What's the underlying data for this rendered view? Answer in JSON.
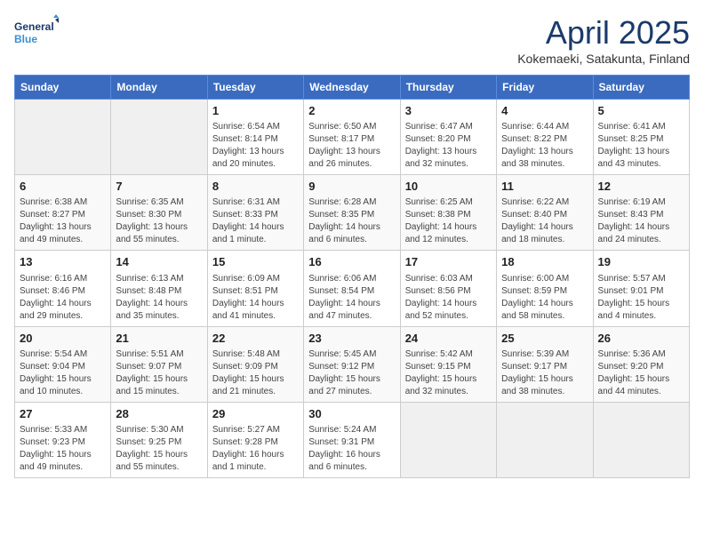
{
  "header": {
    "logo_line1": "General",
    "logo_line2": "Blue",
    "month_title": "April 2025",
    "location": "Kokemaeki, Satakunta, Finland"
  },
  "weekdays": [
    "Sunday",
    "Monday",
    "Tuesday",
    "Wednesday",
    "Thursday",
    "Friday",
    "Saturday"
  ],
  "weeks": [
    [
      {
        "day": "",
        "sunrise": "",
        "sunset": "",
        "daylight": ""
      },
      {
        "day": "",
        "sunrise": "",
        "sunset": "",
        "daylight": ""
      },
      {
        "day": "1",
        "sunrise": "Sunrise: 6:54 AM",
        "sunset": "Sunset: 8:14 PM",
        "daylight": "Daylight: 13 hours and 20 minutes."
      },
      {
        "day": "2",
        "sunrise": "Sunrise: 6:50 AM",
        "sunset": "Sunset: 8:17 PM",
        "daylight": "Daylight: 13 hours and 26 minutes."
      },
      {
        "day": "3",
        "sunrise": "Sunrise: 6:47 AM",
        "sunset": "Sunset: 8:20 PM",
        "daylight": "Daylight: 13 hours and 32 minutes."
      },
      {
        "day": "4",
        "sunrise": "Sunrise: 6:44 AM",
        "sunset": "Sunset: 8:22 PM",
        "daylight": "Daylight: 13 hours and 38 minutes."
      },
      {
        "day": "5",
        "sunrise": "Sunrise: 6:41 AM",
        "sunset": "Sunset: 8:25 PM",
        "daylight": "Daylight: 13 hours and 43 minutes."
      }
    ],
    [
      {
        "day": "6",
        "sunrise": "Sunrise: 6:38 AM",
        "sunset": "Sunset: 8:27 PM",
        "daylight": "Daylight: 13 hours and 49 minutes."
      },
      {
        "day": "7",
        "sunrise": "Sunrise: 6:35 AM",
        "sunset": "Sunset: 8:30 PM",
        "daylight": "Daylight: 13 hours and 55 minutes."
      },
      {
        "day": "8",
        "sunrise": "Sunrise: 6:31 AM",
        "sunset": "Sunset: 8:33 PM",
        "daylight": "Daylight: 14 hours and 1 minute."
      },
      {
        "day": "9",
        "sunrise": "Sunrise: 6:28 AM",
        "sunset": "Sunset: 8:35 PM",
        "daylight": "Daylight: 14 hours and 6 minutes."
      },
      {
        "day": "10",
        "sunrise": "Sunrise: 6:25 AM",
        "sunset": "Sunset: 8:38 PM",
        "daylight": "Daylight: 14 hours and 12 minutes."
      },
      {
        "day": "11",
        "sunrise": "Sunrise: 6:22 AM",
        "sunset": "Sunset: 8:40 PM",
        "daylight": "Daylight: 14 hours and 18 minutes."
      },
      {
        "day": "12",
        "sunrise": "Sunrise: 6:19 AM",
        "sunset": "Sunset: 8:43 PM",
        "daylight": "Daylight: 14 hours and 24 minutes."
      }
    ],
    [
      {
        "day": "13",
        "sunrise": "Sunrise: 6:16 AM",
        "sunset": "Sunset: 8:46 PM",
        "daylight": "Daylight: 14 hours and 29 minutes."
      },
      {
        "day": "14",
        "sunrise": "Sunrise: 6:13 AM",
        "sunset": "Sunset: 8:48 PM",
        "daylight": "Daylight: 14 hours and 35 minutes."
      },
      {
        "day": "15",
        "sunrise": "Sunrise: 6:09 AM",
        "sunset": "Sunset: 8:51 PM",
        "daylight": "Daylight: 14 hours and 41 minutes."
      },
      {
        "day": "16",
        "sunrise": "Sunrise: 6:06 AM",
        "sunset": "Sunset: 8:54 PM",
        "daylight": "Daylight: 14 hours and 47 minutes."
      },
      {
        "day": "17",
        "sunrise": "Sunrise: 6:03 AM",
        "sunset": "Sunset: 8:56 PM",
        "daylight": "Daylight: 14 hours and 52 minutes."
      },
      {
        "day": "18",
        "sunrise": "Sunrise: 6:00 AM",
        "sunset": "Sunset: 8:59 PM",
        "daylight": "Daylight: 14 hours and 58 minutes."
      },
      {
        "day": "19",
        "sunrise": "Sunrise: 5:57 AM",
        "sunset": "Sunset: 9:01 PM",
        "daylight": "Daylight: 15 hours and 4 minutes."
      }
    ],
    [
      {
        "day": "20",
        "sunrise": "Sunrise: 5:54 AM",
        "sunset": "Sunset: 9:04 PM",
        "daylight": "Daylight: 15 hours and 10 minutes."
      },
      {
        "day": "21",
        "sunrise": "Sunrise: 5:51 AM",
        "sunset": "Sunset: 9:07 PM",
        "daylight": "Daylight: 15 hours and 15 minutes."
      },
      {
        "day": "22",
        "sunrise": "Sunrise: 5:48 AM",
        "sunset": "Sunset: 9:09 PM",
        "daylight": "Daylight: 15 hours and 21 minutes."
      },
      {
        "day": "23",
        "sunrise": "Sunrise: 5:45 AM",
        "sunset": "Sunset: 9:12 PM",
        "daylight": "Daylight: 15 hours and 27 minutes."
      },
      {
        "day": "24",
        "sunrise": "Sunrise: 5:42 AM",
        "sunset": "Sunset: 9:15 PM",
        "daylight": "Daylight: 15 hours and 32 minutes."
      },
      {
        "day": "25",
        "sunrise": "Sunrise: 5:39 AM",
        "sunset": "Sunset: 9:17 PM",
        "daylight": "Daylight: 15 hours and 38 minutes."
      },
      {
        "day": "26",
        "sunrise": "Sunrise: 5:36 AM",
        "sunset": "Sunset: 9:20 PM",
        "daylight": "Daylight: 15 hours and 44 minutes."
      }
    ],
    [
      {
        "day": "27",
        "sunrise": "Sunrise: 5:33 AM",
        "sunset": "Sunset: 9:23 PM",
        "daylight": "Daylight: 15 hours and 49 minutes."
      },
      {
        "day": "28",
        "sunrise": "Sunrise: 5:30 AM",
        "sunset": "Sunset: 9:25 PM",
        "daylight": "Daylight: 15 hours and 55 minutes."
      },
      {
        "day": "29",
        "sunrise": "Sunrise: 5:27 AM",
        "sunset": "Sunset: 9:28 PM",
        "daylight": "Daylight: 16 hours and 1 minute."
      },
      {
        "day": "30",
        "sunrise": "Sunrise: 5:24 AM",
        "sunset": "Sunset: 9:31 PM",
        "daylight": "Daylight: 16 hours and 6 minutes."
      },
      {
        "day": "",
        "sunrise": "",
        "sunset": "",
        "daylight": ""
      },
      {
        "day": "",
        "sunrise": "",
        "sunset": "",
        "daylight": ""
      },
      {
        "day": "",
        "sunrise": "",
        "sunset": "",
        "daylight": ""
      }
    ]
  ]
}
